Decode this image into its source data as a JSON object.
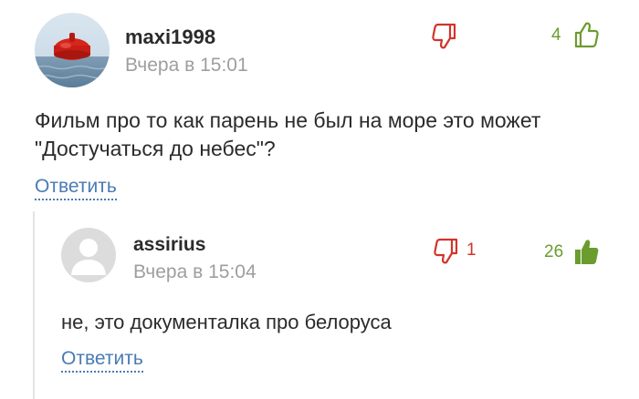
{
  "colors": {
    "like_green": "#6b9c2e",
    "dislike_red": "#d2342b",
    "link_blue": "#4a7bb4",
    "muted_gray": "#9e9e9e"
  },
  "comments": [
    {
      "username": "maxi1998",
      "time": "Вчера в 15:01",
      "avatar_icon": "buoy-on-sea-avatar",
      "text": "Фильм про то как парень не был на море это может \"Достучаться до небес\"?",
      "likes": "4",
      "dislike_icon": "thumb-down-outline-icon",
      "like_icon": "thumb-up-outline-icon",
      "reply_label": "Ответить"
    },
    {
      "username": "assirius",
      "time": "Вчера в 15:04",
      "avatar_icon": "default-user-avatar",
      "text": "не, это документалка про белоруса",
      "dislikes": "1",
      "likes": "26",
      "dislike_icon": "thumb-down-outline-icon",
      "like_icon": "thumb-up-filled-icon",
      "reply_label": "Ответить"
    }
  ]
}
